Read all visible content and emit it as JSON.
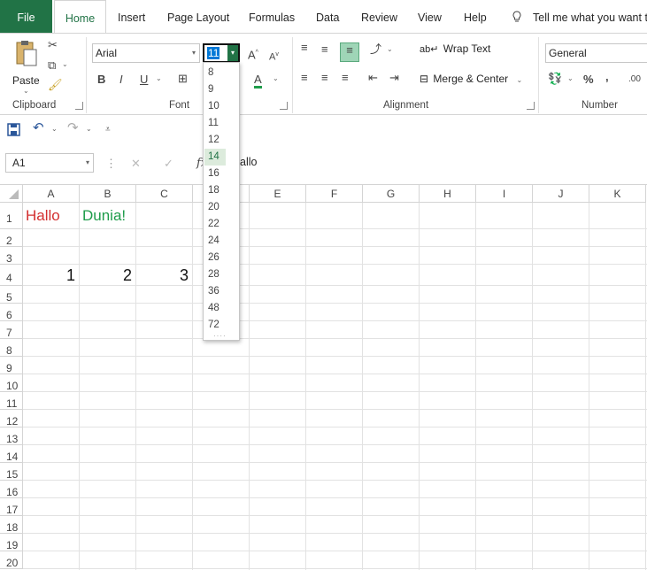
{
  "tabs": {
    "file": "File",
    "home": "Home",
    "insert": "Insert",
    "page_layout": "Page Layout",
    "formulas": "Formulas",
    "data": "Data",
    "review": "Review",
    "view": "View",
    "help": "Help",
    "tell_me": "Tell me what you want t"
  },
  "ribbon": {
    "clipboard": {
      "paste_label": "Paste",
      "group_label": "Clipboard"
    },
    "font": {
      "font_name": "Arial",
      "font_size": "11",
      "bold": "B",
      "italic": "I",
      "underline": "U",
      "grow": "A",
      "shrink": "A",
      "group_label": "Font"
    },
    "alignment": {
      "wrap_text": "Wrap Text",
      "merge_center": "Merge & Center",
      "group_label": "Alignment"
    },
    "number": {
      "format": "General",
      "percent": "%",
      "comma": ",",
      "decimals": ".00",
      "group_label": "Number"
    }
  },
  "formula_bar": {
    "name_box": "A1",
    "fx": "fx",
    "content": "allo"
  },
  "font_size_list": {
    "options": [
      "8",
      "9",
      "10",
      "11",
      "12",
      "14",
      "16",
      "18",
      "20",
      "22",
      "24",
      "26",
      "28",
      "36",
      "48",
      "72"
    ],
    "highlighted": "14"
  },
  "columns": [
    "A",
    "B",
    "C",
    "D",
    "E",
    "F",
    "G",
    "H",
    "I",
    "J",
    "K"
  ],
  "rows": [
    "1",
    "2",
    "3",
    "4",
    "5",
    "6",
    "7",
    "8",
    "9",
    "10",
    "11",
    "12",
    "13",
    "14",
    "15",
    "16",
    "17",
    "18",
    "19",
    "20"
  ],
  "cells": {
    "A1": {
      "value": "Hallo",
      "color": "#d32f2f"
    },
    "B1": {
      "value": "Dunia!",
      "color": "#1e9c4a"
    },
    "A4": {
      "value": "1"
    },
    "B4": {
      "value": "2"
    },
    "C4": {
      "value": "3"
    }
  },
  "colors": {
    "accent": "#217346",
    "grid_line": "#e2e2e2",
    "highlight": "#dcebdc"
  }
}
